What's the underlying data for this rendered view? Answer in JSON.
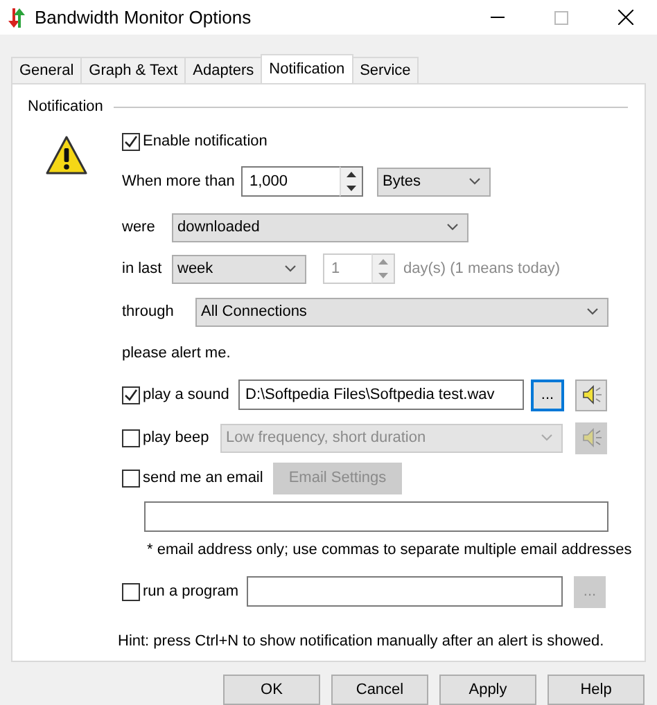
{
  "window": {
    "title": "Bandwidth Monitor Options"
  },
  "tabs": [
    {
      "label": "General",
      "selected": false
    },
    {
      "label": "Graph & Text",
      "selected": false
    },
    {
      "label": "Adapters",
      "selected": false
    },
    {
      "label": "Notification",
      "selected": true
    },
    {
      "label": "Service",
      "selected": false
    }
  ],
  "group": {
    "title": "Notification"
  },
  "enable": {
    "label": "Enable notification",
    "checked": true
  },
  "threshold": {
    "label": "When more than",
    "value": "1,000",
    "unit": "Bytes"
  },
  "direction": {
    "label": "were",
    "value": "downloaded"
  },
  "period": {
    "label": "in last",
    "value": "week",
    "count": "1",
    "disabled": true,
    "note": "day(s) (1 means today)"
  },
  "through": {
    "label": "through",
    "value": "All Connections"
  },
  "alert_label": "please alert me.",
  "sound": {
    "label": "play a sound",
    "checked": true,
    "path": "D:\\Softpedia Files\\Softpedia test.wav",
    "browse": "..."
  },
  "beep": {
    "label": "play beep",
    "checked": false,
    "value": "Low frequency, short duration",
    "disabled": true
  },
  "email": {
    "label": "send me an email",
    "checked": false,
    "settings": "Email Settings",
    "disabled": true,
    "note": "* email address only; use commas to separate multiple email addresses"
  },
  "program": {
    "label": "run a program",
    "checked": false,
    "browse": "...",
    "disabled": true
  },
  "hint": "Hint: press Ctrl+N to show notification manually after an alert is showed.",
  "buttons": [
    "OK",
    "Cancel",
    "Apply",
    "Help"
  ]
}
